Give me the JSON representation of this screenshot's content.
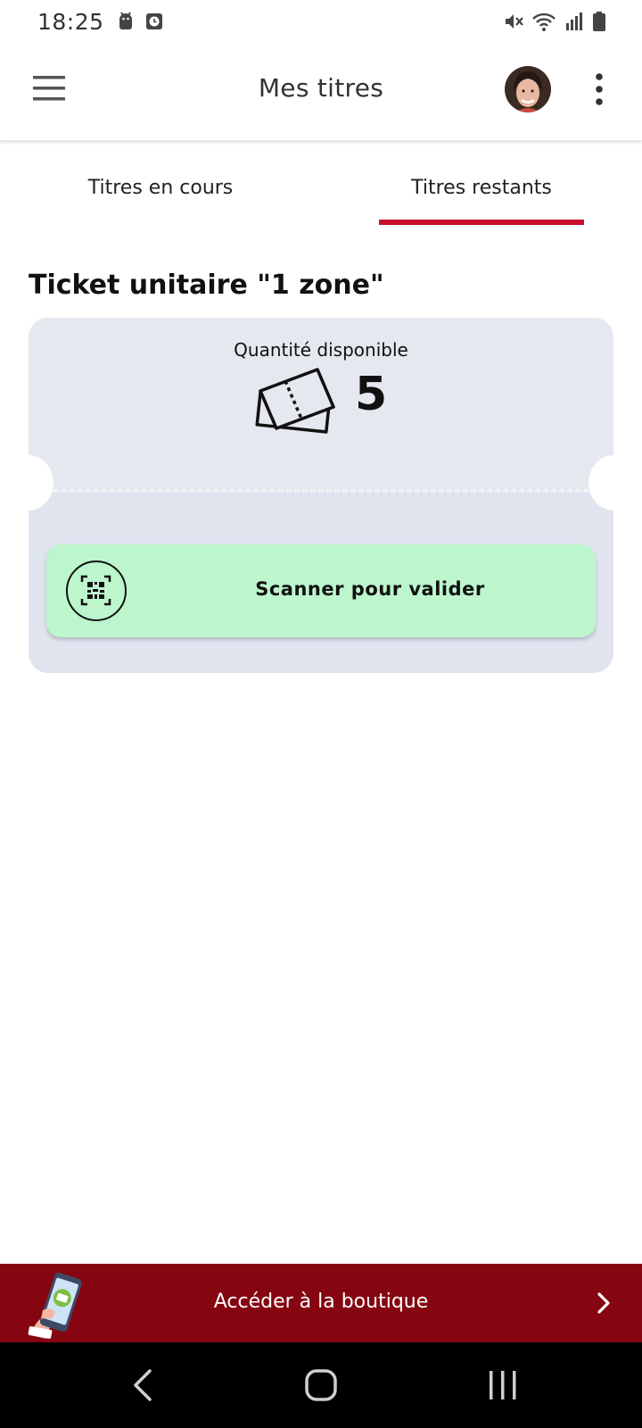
{
  "status_bar": {
    "time": "18:25",
    "left_icons": [
      "android-icon",
      "clock-icon"
    ],
    "right_icons": [
      "mute-icon",
      "wifi-icon",
      "signal-icon",
      "battery-icon"
    ]
  },
  "app_bar": {
    "title": "Mes titres",
    "menu_icon": "hamburger-menu-icon",
    "more_icon": "more-vertical-icon"
  },
  "tabs": [
    {
      "label": "Titres en cours",
      "selected": false
    },
    {
      "label": "Titres restants",
      "selected": true
    }
  ],
  "ticket": {
    "title": "Ticket unitaire \"1 zone\"",
    "quantity_label": "Quantité disponible",
    "quantity": "5",
    "scan_label": "Scanner pour valider",
    "scan_icon": "qr-scan-icon"
  },
  "shop_banner": {
    "label": "Accéder à la boutique",
    "chevron_icon": "chevron-right-icon"
  },
  "nav_bar": {
    "icons": [
      "back-icon",
      "home-icon",
      "recents-icon"
    ]
  },
  "colors": {
    "accent_red": "#c8102e",
    "banner_red": "#850611",
    "scan_green": "#bdf5cd",
    "ticket_bg": "#e5e8ef"
  }
}
